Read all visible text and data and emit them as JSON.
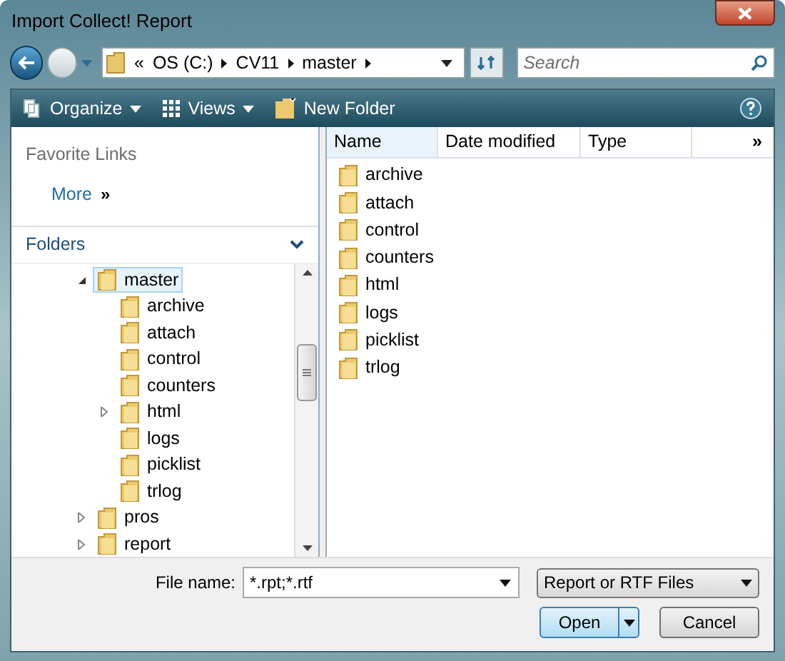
{
  "window": {
    "title": "Import Collect! Report"
  },
  "breadcrumb": {
    "overflow": "«",
    "parts": [
      "OS (C:)",
      "CV11",
      "master"
    ]
  },
  "search": {
    "placeholder": "Search"
  },
  "toolbar": [
    "Organize",
    "Views",
    "New Folder"
  ],
  "favorite_links": {
    "heading": "Favorite Links",
    "more": "More",
    "more_arrow": "»"
  },
  "folders": {
    "heading": "Folders",
    "tree": [
      {
        "label": "master",
        "expanded": true,
        "selected": true,
        "children": [
          {
            "label": "archive",
            "selected": false
          },
          {
            "label": "attach",
            "selected": false
          },
          {
            "label": "control",
            "selected": false
          },
          {
            "label": "counters",
            "selected": false
          },
          {
            "label": "html",
            "expanded": false,
            "selected": false
          },
          {
            "label": "logs",
            "selected": false
          },
          {
            "label": "picklist",
            "selected": false
          },
          {
            "label": "trlog",
            "selected": false
          }
        ]
      },
      {
        "label": "pros",
        "expanded": false,
        "selected": false
      },
      {
        "label": "report",
        "expanded": false,
        "selected": false
      }
    ]
  },
  "file_list": {
    "columns": [
      "Name",
      "Date modified",
      "Type"
    ],
    "more_columns": "»",
    "items": [
      "archive",
      "attach",
      "control",
      "counters",
      "html",
      "logs",
      "picklist",
      "trlog"
    ]
  },
  "file_name": {
    "label": "File name:",
    "value": "*.rpt;*.rtf"
  },
  "file_type": {
    "value": "Report or RTF Files"
  },
  "buttons": [
    "Open",
    "Cancel"
  ]
}
